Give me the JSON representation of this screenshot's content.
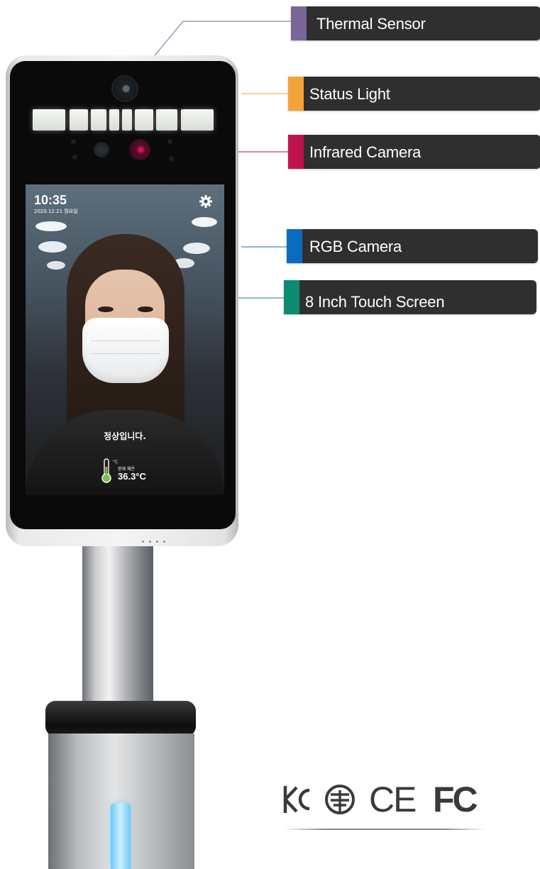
{
  "callouts": [
    {
      "id": "thermal-sensor",
      "label": "Thermal Sensor",
      "color": "#7a6696"
    },
    {
      "id": "status-light",
      "label": "Status Light",
      "color": "#f2a33a"
    },
    {
      "id": "infrared-camera",
      "label": "Infrared Camera",
      "color": "#c0124e"
    },
    {
      "id": "rgb-camera",
      "label": "RGB Camera",
      "color": "#0a6cc0"
    },
    {
      "id": "touch-screen",
      "label": "8 Inch Touch Screen",
      "color": "#0e8a72"
    }
  ],
  "screen": {
    "time": "10:35",
    "date": "2020.12.21 월요일",
    "status_message": "정상입니다.",
    "temp_label": "현재 체온",
    "temp_value": "36.3°C",
    "temp_unit": "°C"
  },
  "certifications": {
    "marks": [
      "KC",
      "Telecom",
      "CE",
      "FC"
    ],
    "ce_text": "CE",
    "fc_text": "FC"
  },
  "colors": {
    "callout_bg": "#2f2f30",
    "callout_text": "#ffffff",
    "bezel": "#0a0a0b",
    "base_indicator": "#8fd9ff"
  }
}
